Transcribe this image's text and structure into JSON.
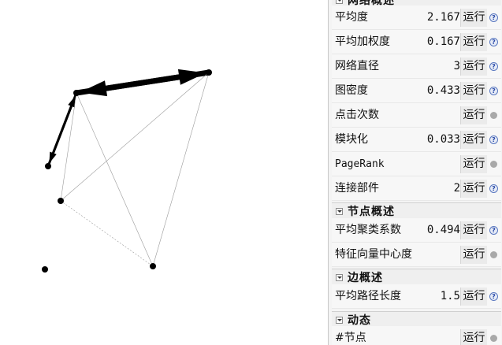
{
  "sections": {
    "network": {
      "title": "网络概述"
    },
    "node": {
      "title": "节点概述"
    },
    "edge": {
      "title": "边概述"
    },
    "dynamic": {
      "title": "动态"
    }
  },
  "stats": [
    {
      "label": "平均度",
      "value": "2.167",
      "button": "运行",
      "icon": "help-icon"
    },
    {
      "label": "平均加权度",
      "value": "0.167",
      "button": "运行",
      "icon": "help-icon"
    },
    {
      "label": "网络直径",
      "value": "3",
      "button": "运行",
      "icon": "help-icon"
    },
    {
      "label": "图密度",
      "value": "0.433",
      "button": "运行",
      "icon": "help-icon"
    },
    {
      "label": "点击次数",
      "value": "",
      "button": "运行",
      "icon": "dot-icon"
    },
    {
      "label": "模块化",
      "value": "0.033",
      "button": "运行",
      "icon": "help-icon"
    },
    {
      "label": "PageRank",
      "value": "",
      "button": "运行",
      "icon": "dot-icon"
    },
    {
      "label": "连接部件",
      "value": "2",
      "button": "运行",
      "icon": "help-icon"
    },
    {
      "label": "平均聚类系数",
      "value": "0.494",
      "button": "运行",
      "icon": "help-icon"
    },
    {
      "label": "特征向量中心度",
      "value": "",
      "button": "运行",
      "icon": "dot-icon"
    },
    {
      "label": "平均路径长度",
      "value": "1.5",
      "button": "运行",
      "icon": "help-icon"
    },
    {
      "label": "#节点",
      "value": "",
      "button": "运行",
      "icon": "dot-icon"
    }
  ],
  "graph": {
    "node_count": 6,
    "edges": [
      {
        "from": 0,
        "to": 1,
        "weight": "heavy",
        "directed": true
      },
      {
        "from": 1,
        "to": 0,
        "weight": "heavy",
        "directed": true
      },
      {
        "from": 1,
        "to": 2,
        "weight": "medium",
        "directed": true
      },
      {
        "from": 2,
        "to": 1,
        "weight": "medium",
        "directed": true
      },
      {
        "from": 1,
        "to": 3,
        "weight": "light",
        "directed": false
      },
      {
        "from": 1,
        "to": 4,
        "weight": "light",
        "directed": false
      },
      {
        "from": 0,
        "to": 3,
        "weight": "light",
        "directed": false
      },
      {
        "from": 0,
        "to": 4,
        "weight": "light",
        "directed": false
      },
      {
        "from": 3,
        "to": 4,
        "weight": "dashed",
        "directed": false
      }
    ],
    "colors": {
      "edge": "#000000",
      "light_edge": "#9a9a9a",
      "node": "#000000"
    }
  }
}
